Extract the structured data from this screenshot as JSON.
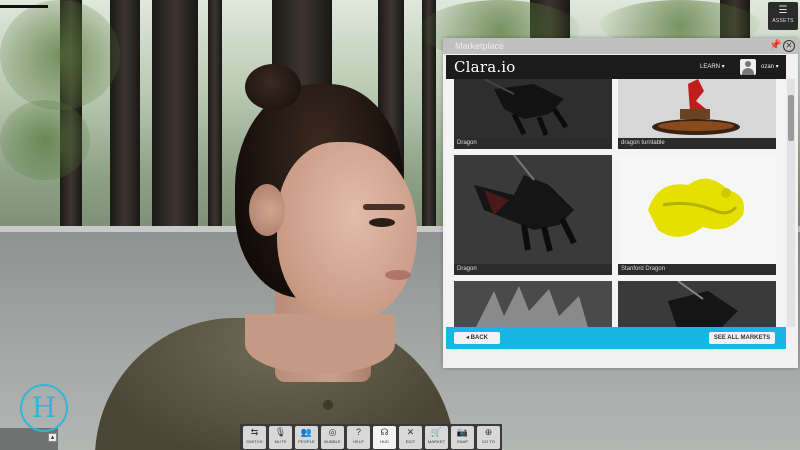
{
  "window": {
    "assets_label": "ASSETS",
    "assets_icon": "list-icon"
  },
  "marketplace": {
    "title": "Marketplace",
    "pin_icon": "pin-icon",
    "close_icon": "close-icon",
    "header": {
      "logo": "Clara.io",
      "learn_menu": "LEARN ▾",
      "username": "ozan ▾"
    },
    "items": [
      {
        "caption": "Dragon",
        "thumb": "dark-dragon"
      },
      {
        "caption": "dragon turntable",
        "thumb": "red-dragon"
      },
      {
        "caption": "Dragon",
        "thumb": "dark-dragon-large"
      },
      {
        "caption": "Stanford Dragon",
        "thumb": "yellow-dragon"
      },
      {
        "caption": "",
        "thumb": "spiky-dragon"
      },
      {
        "caption": "",
        "thumb": "dark-dragon-partial"
      }
    ],
    "back_label": "◂ BACK",
    "see_all_label": "SEE ALL MARKETS"
  },
  "brand": {
    "logo_letter": "H",
    "accent": "#2fb6d8"
  },
  "toolbar": {
    "items": [
      {
        "label": "SWITCH",
        "icon": "switch-icon",
        "glyph": "⇆"
      },
      {
        "label": "MUTE",
        "icon": "microphone-icon",
        "glyph": "🎙"
      },
      {
        "label": "PEOPLE",
        "icon": "people-icon",
        "glyph": "👥"
      },
      {
        "label": "BUBBLE",
        "icon": "bubble-icon",
        "glyph": "◎"
      },
      {
        "label": "HELP",
        "icon": "help-icon",
        "glyph": "?"
      },
      {
        "label": "HUD",
        "icon": "hud-icon",
        "glyph": "☊"
      },
      {
        "label": "EDIT",
        "icon": "edit-icon",
        "glyph": "✕"
      },
      {
        "label": "MARKET",
        "icon": "cart-icon",
        "glyph": "🛒"
      },
      {
        "label": "SNAP",
        "icon": "camera-icon",
        "glyph": "📷"
      },
      {
        "label": "GO TO",
        "icon": "globe-icon",
        "glyph": "⊕"
      }
    ]
  }
}
